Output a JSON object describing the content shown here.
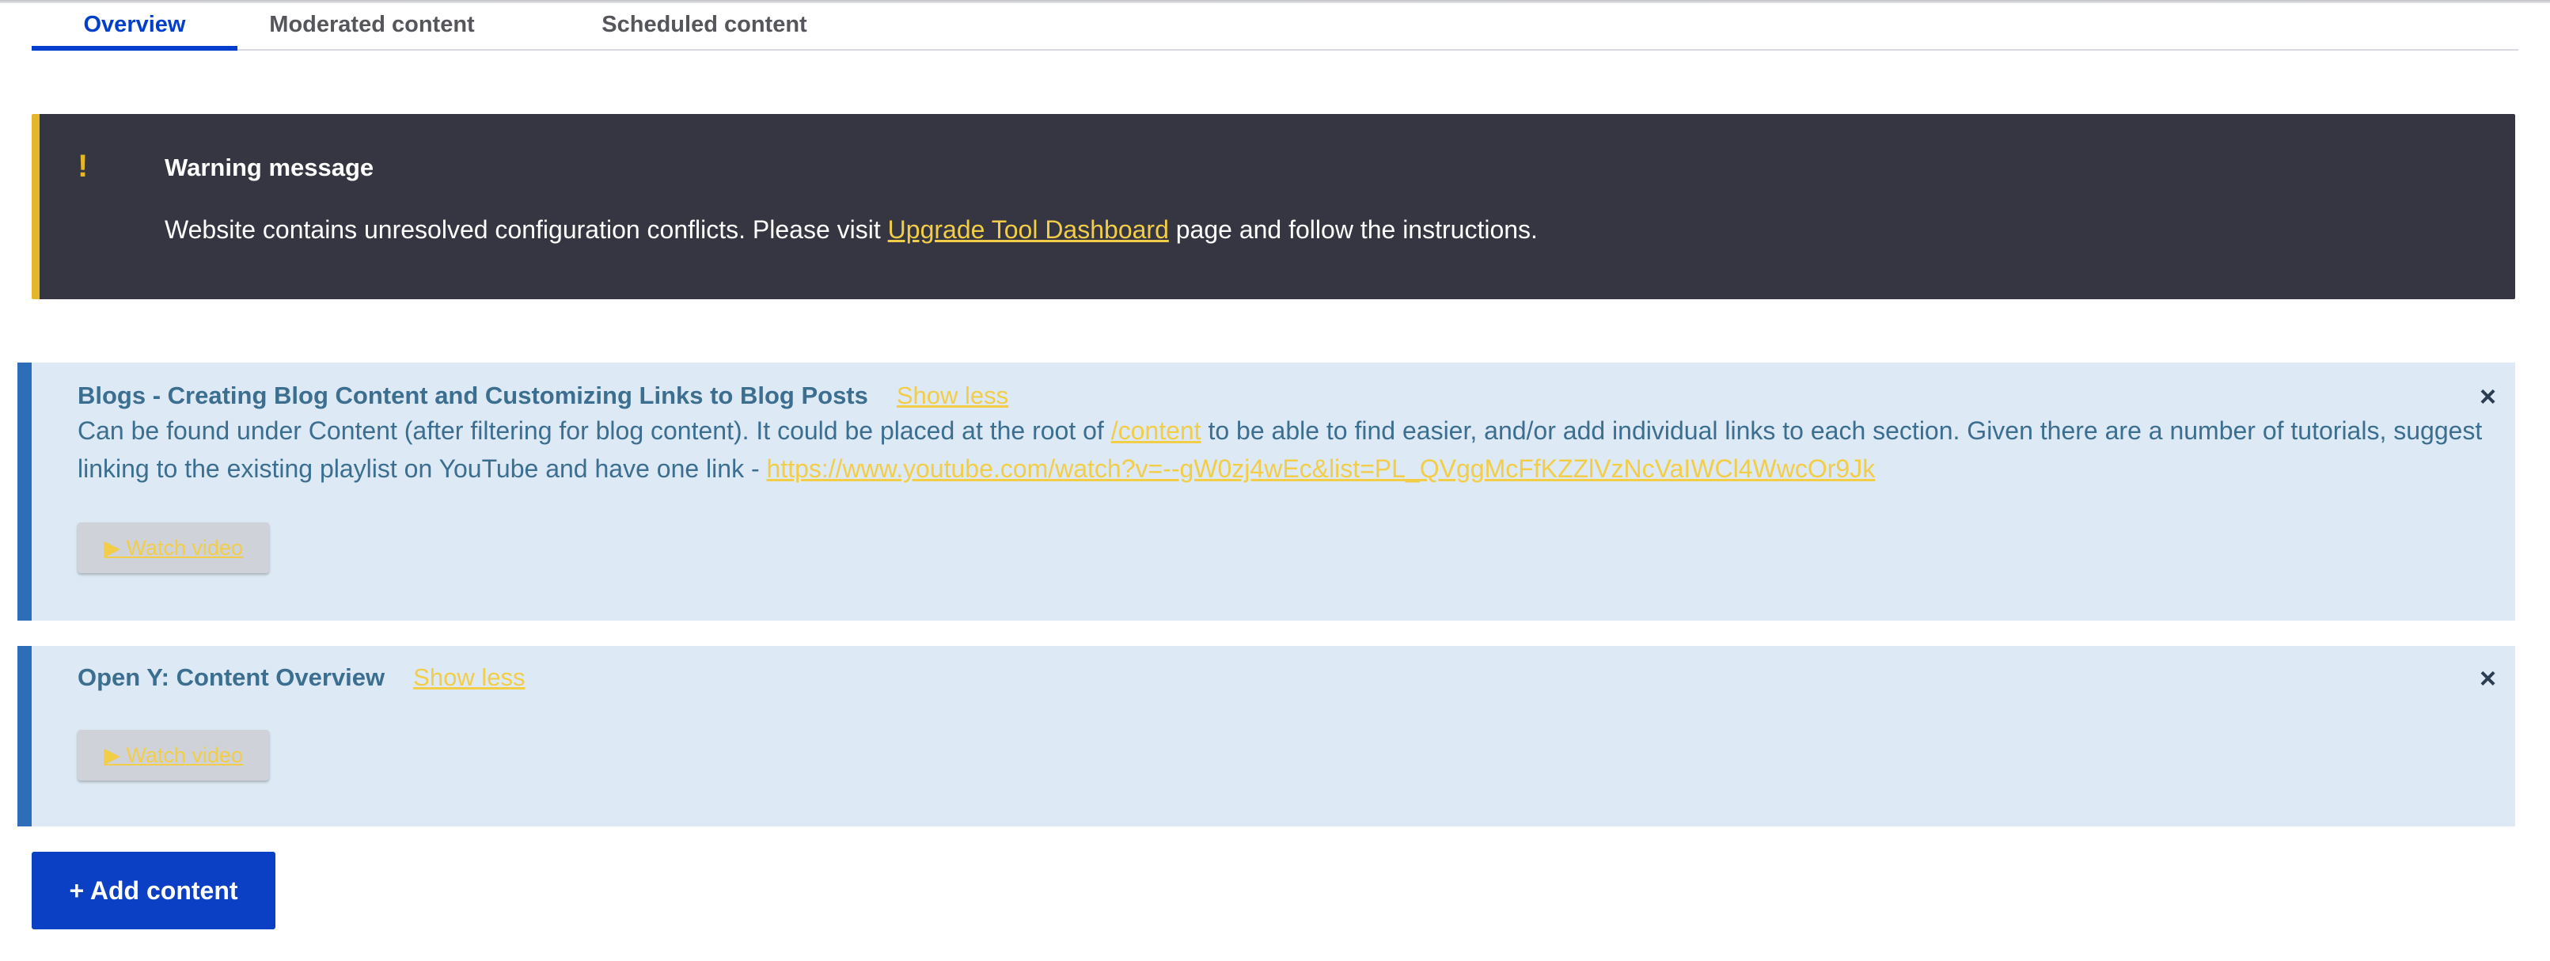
{
  "tabs": [
    {
      "label": "Overview",
      "active": true
    },
    {
      "label": "Moderated content",
      "active": false
    },
    {
      "label": "Scheduled content",
      "active": false
    }
  ],
  "warning": {
    "icon": "!",
    "title": "Warning message",
    "text_before": "Website contains unresolved configuration conflicts. Please visit ",
    "link": "Upgrade Tool Dashboard",
    "text_after": " page and follow the instructions."
  },
  "help_blocks": [
    {
      "title": "Blogs - Creating Blog Content and Customizing Links to Blog Posts",
      "toggle": "Show less",
      "text1": "Can be found under Content (after filtering for blog content). It could be placed at the root of ",
      "link1": "/content",
      "text2": " to be able to find easier, and/or add individual links to each section. Given there are a number of tutorials, suggest linking to the existing playlist on YouTube and have one link - ",
      "link2": "https://www.youtube.com/watch?v=--gW0zj4wEc&list=PL_QVggMcFfKZZlVzNcVaIWCl4WwcOr9Jk",
      "watch": "▶ Watch video",
      "close": "×"
    },
    {
      "title": "Open Y: Content Overview",
      "toggle": "Show less",
      "watch": "▶ Watch video",
      "close": "×"
    }
  ],
  "add_button": "+ Add content",
  "colors": {
    "accent": "#003ecc",
    "warning_bg": "#353641",
    "warning_stripe": "#e4b62a",
    "link": "#f2cd47",
    "help_bg": "#dde9f4",
    "help_stripe": "#2e6eb8",
    "add_button_bg": "#0b3fc4"
  }
}
